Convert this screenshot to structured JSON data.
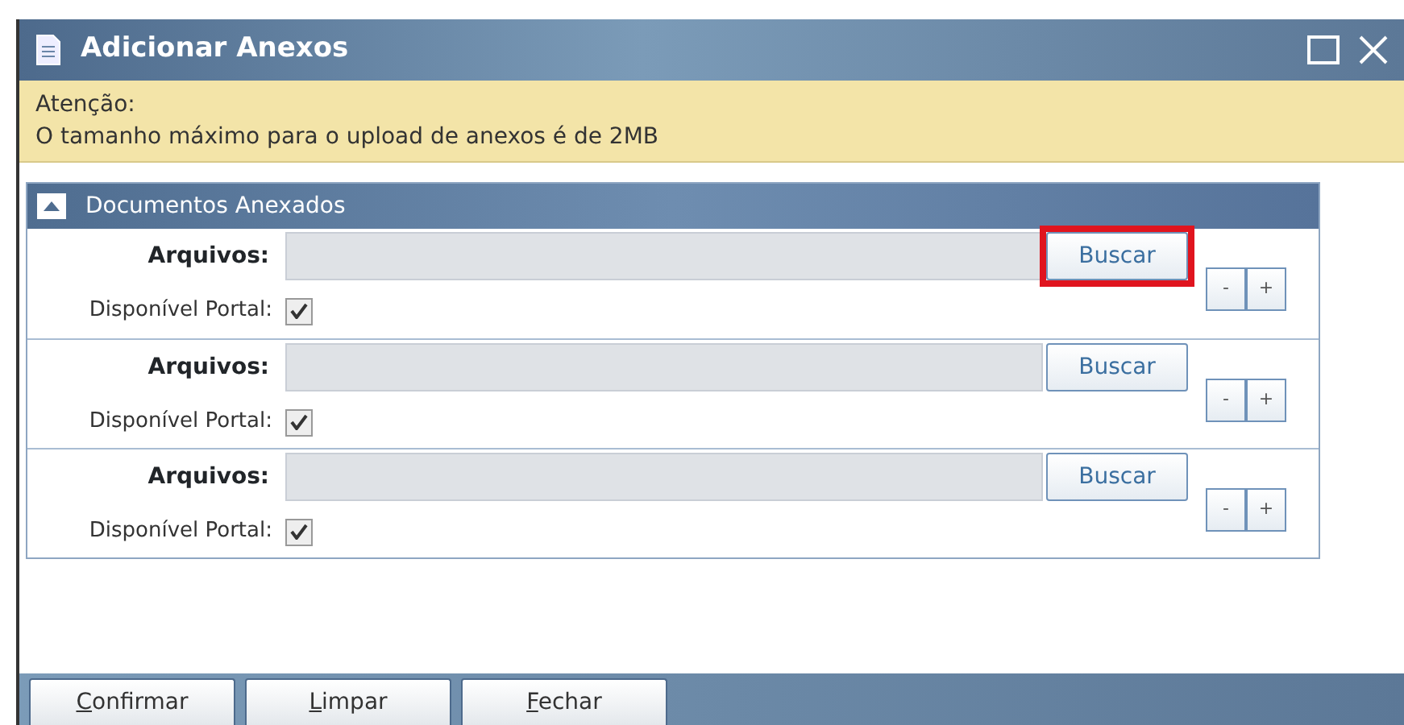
{
  "window": {
    "title": "Adicionar Anexos"
  },
  "alert": {
    "heading": "Atenção:",
    "message": "O tamanho máximo para o upload de anexos é de 2MB"
  },
  "panel": {
    "title": "Documentos Anexados",
    "expanded": true,
    "rows": [
      {
        "file_label": "Arquivos:",
        "browse": "Buscar",
        "highlighted": true,
        "portal_label": "Disponível Portal:",
        "checked": true,
        "remove": "-",
        "add": "+"
      },
      {
        "file_label": "Arquivos:",
        "browse": "Buscar",
        "highlighted": false,
        "portal_label": "Disponível Portal:",
        "checked": true,
        "remove": "-",
        "add": "+"
      },
      {
        "file_label": "Arquivos:",
        "browse": "Buscar",
        "highlighted": false,
        "portal_label": "Disponível Portal:",
        "checked": true,
        "remove": "-",
        "add": "+"
      }
    ]
  },
  "footer_buttons": [
    {
      "label": "Confirmar",
      "mnemonic_underlined": true
    },
    {
      "label": "Limpar",
      "mnemonic_underlined": true
    },
    {
      "label": "Fechar",
      "mnemonic_underlined": true
    }
  ]
}
